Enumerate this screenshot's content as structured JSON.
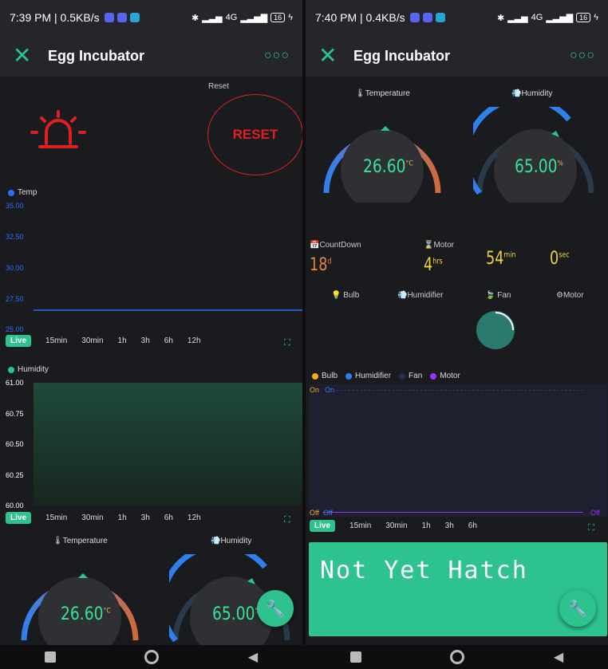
{
  "left": {
    "status": {
      "time": "7:39 PM | 0.5KB/s",
      "net": "4G",
      "battery": "16"
    },
    "appbar": {
      "title": "Egg Incubator"
    },
    "reset": {
      "label": "Reset",
      "button": "RESET"
    },
    "temp_chart": {
      "legend": "Temp",
      "yticks": [
        "35.00",
        "32.50",
        "30.00",
        "27.50",
        "25.00"
      ],
      "tabs": [
        "Live",
        "15min",
        "30min",
        "1h",
        "3h",
        "6h",
        "12h"
      ]
    },
    "hum_chart": {
      "legend": "Humidity",
      "yticks": [
        "61.00",
        "60.75",
        "60.50",
        "60.25",
        "60.00"
      ],
      "tabs": [
        "Live",
        "15min",
        "30min",
        "1h",
        "3h",
        "6h",
        "12h"
      ]
    },
    "gauges": {
      "temp_label": "Temperature",
      "temp_value": "26.60",
      "temp_unit": "°C",
      "hum_label": "Humidity",
      "hum_value": "65.00",
      "hum_unit": "%"
    }
  },
  "right": {
    "status": {
      "time": "7:40 PM | 0.4KB/s",
      "net": "4G",
      "battery": "16"
    },
    "appbar": {
      "title": "Egg Incubator"
    },
    "gauges": {
      "temp_label": "Temperature",
      "temp_value": "26.60",
      "temp_unit": "°C",
      "hum_label": "Humidity",
      "hum_value": "65.00",
      "hum_unit": "%"
    },
    "countdown": {
      "countdown_label": "CountDown",
      "motor_label": "Motor",
      "days": "18",
      "days_unit": "d",
      "hrs": "4",
      "hrs_unit": "hrs",
      "min": "54",
      "min_unit": "min",
      "sec": "0",
      "sec_unit": "sec"
    },
    "status_labels": {
      "bulb": "Bulb",
      "humidifier": "Humidifier",
      "fan": "Fan",
      "motor": "Motor"
    },
    "chart": {
      "legend": [
        "Bulb",
        "Humidifier",
        "Fan",
        "Motor"
      ],
      "on": "On",
      "off": "Off",
      "tabs": [
        "Live",
        "15min",
        "30min",
        "1h",
        "3h",
        "6h"
      ]
    },
    "lcd": {
      "text": "Not Yet Hatch"
    }
  },
  "colors": {
    "accent": "#2ec28e",
    "bulb": "#f5a623",
    "humidifier": "#2f80ed",
    "fan": "#2b2f45",
    "motor": "#9b30ff",
    "reset": "#e02020"
  },
  "chart_data": [
    {
      "type": "line",
      "title": "",
      "series": [
        {
          "name": "Temp",
          "values": [
            26.6,
            26.6
          ]
        }
      ],
      "ylim": [
        25,
        35
      ]
    },
    {
      "type": "area",
      "title": "",
      "series": [
        {
          "name": "Humidity",
          "values": [
            61,
            61
          ]
        }
      ],
      "ylim": [
        60,
        61
      ]
    }
  ]
}
